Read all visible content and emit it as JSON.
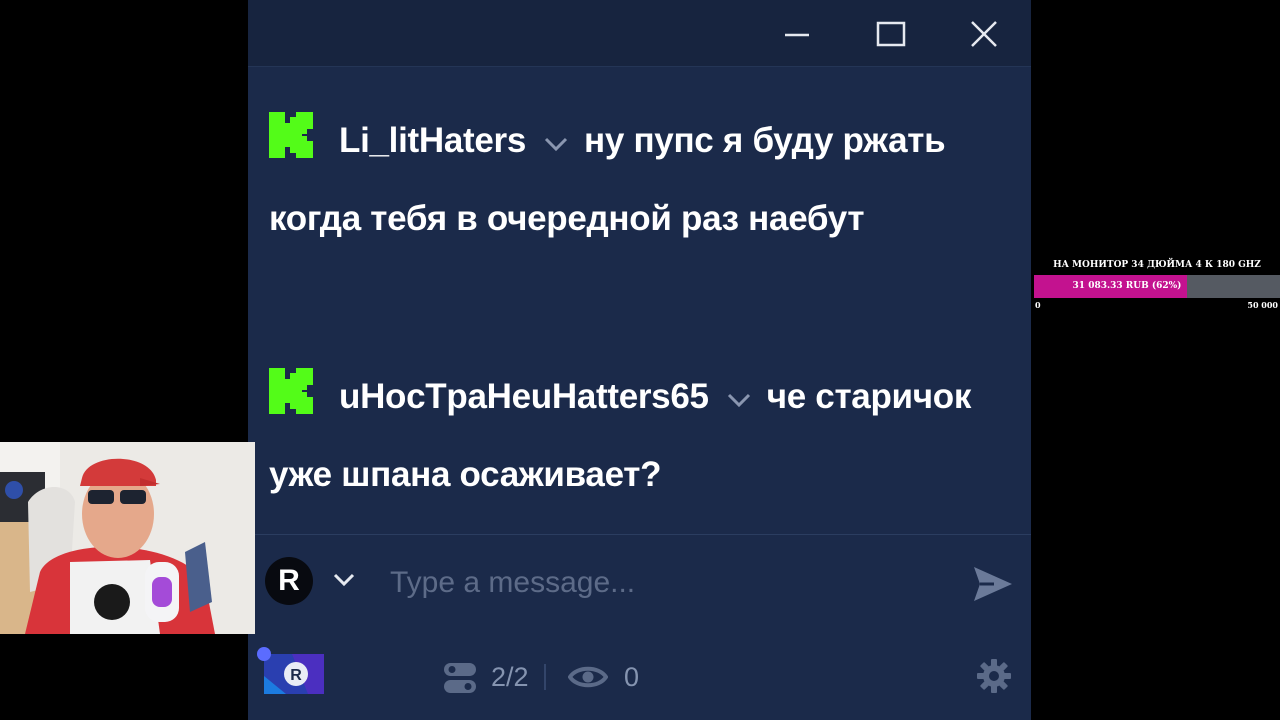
{
  "window": {
    "controls": {
      "minimize": "minimize-icon",
      "maximize": "maximize-icon",
      "close": "close-icon"
    }
  },
  "messages": [
    {
      "badge": "kick-icon",
      "username": "Li_litHaters",
      "text": "ну пупс я буду ржать когда тебя в очередной раз наебут"
    },
    {
      "badge": "kick-icon",
      "username": "uHocTpaHeuHatters65",
      "text": "че старичок уже шпана осаживает?"
    }
  ],
  "composer": {
    "avatar_letter": "R",
    "placeholder": "Type a message...",
    "send_icon": "send-icon"
  },
  "footer": {
    "viewers": "2/2",
    "eye_count": "0"
  },
  "goal": {
    "title": "НА МОНИТОР 34 ДЮЙМА 4 К 180 GHZ",
    "amount_label": "31 083.33 RUB (62%)",
    "progress": 0.62,
    "min": "0",
    "max": "50 000",
    "fill_color": "#c3128f"
  },
  "colors": {
    "background": "#1b2a4a",
    "kick_green": "#53fc18"
  }
}
